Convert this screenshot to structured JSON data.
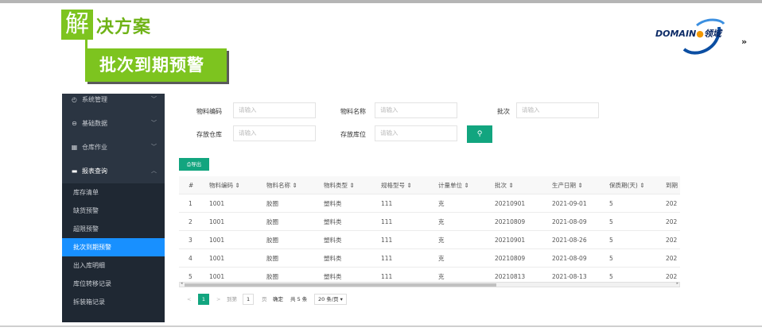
{
  "slide": {
    "jie_char": "解",
    "title_rest": "决方案",
    "subtitle": "批次到期预警",
    "logo_text": "DOMAIN",
    "logo_suffix": "领域",
    "logo_arrows": "»"
  },
  "sidebar": {
    "groups": [
      {
        "label": "系统管理",
        "icon": "settings-icon"
      },
      {
        "label": "基础数据",
        "icon": "data-icon"
      },
      {
        "label": "仓库作业",
        "icon": "warehouse-icon"
      },
      {
        "label": "报表查询",
        "icon": "report-icon"
      }
    ],
    "subitems": [
      {
        "label": "库存清单"
      },
      {
        "label": "缺货预警"
      },
      {
        "label": "超限预警"
      },
      {
        "label": "批次到期预警",
        "active": true
      },
      {
        "label": "出入库明细"
      },
      {
        "label": "库位转移记录"
      },
      {
        "label": "拆装箱记录"
      }
    ]
  },
  "filters": {
    "code_label": "物料编码",
    "name_label": "物料名称",
    "batch_label": "批次",
    "warehouse_label": "存放仓库",
    "location_label": "存放库位",
    "placeholder": "请输入"
  },
  "toolbar": {
    "export_label": "导出"
  },
  "table": {
    "headers": [
      "#",
      "物料编码 ⇕",
      "物料名称 ⇕",
      "物料类型 ⇕",
      "规格型号 ⇕",
      "计量单位 ⇕",
      "批次 ⇕",
      "生产日期 ⇕",
      "保质期(天) ⇕",
      "到期"
    ],
    "rows": [
      [
        "1",
        "1001",
        "胶圈",
        "塑料类",
        "111",
        "克",
        "20210901",
        "2021-09-01",
        "5",
        "202"
      ],
      [
        "2",
        "1001",
        "胶圈",
        "塑料类",
        "111",
        "克",
        "20210809",
        "2021-08-09",
        "5",
        "202"
      ],
      [
        "3",
        "1001",
        "胶圈",
        "塑料类",
        "111",
        "克",
        "20210901",
        "2021-08-26",
        "5",
        "202"
      ],
      [
        "4",
        "1001",
        "胶圈",
        "塑料类",
        "111",
        "克",
        "20210809",
        "2021-08-09",
        "5",
        "202"
      ],
      [
        "5",
        "1001",
        "胶圈",
        "塑料类",
        "111",
        "克",
        "20210813",
        "2021-08-13",
        "5",
        "202"
      ]
    ]
  },
  "pager": {
    "prev": "<",
    "current": "1",
    "next": ">",
    "goto_label": "到第",
    "goto_value": "1",
    "page_unit": "页",
    "confirm": "确定",
    "total": "共 5 条",
    "page_size": "20 条/页 ▾"
  },
  "colors": {
    "accent_green": "#7dc41f",
    "button_teal": "#12a57f",
    "sidebar_bg": "#2b3542",
    "active_blue": "#1890ff"
  }
}
